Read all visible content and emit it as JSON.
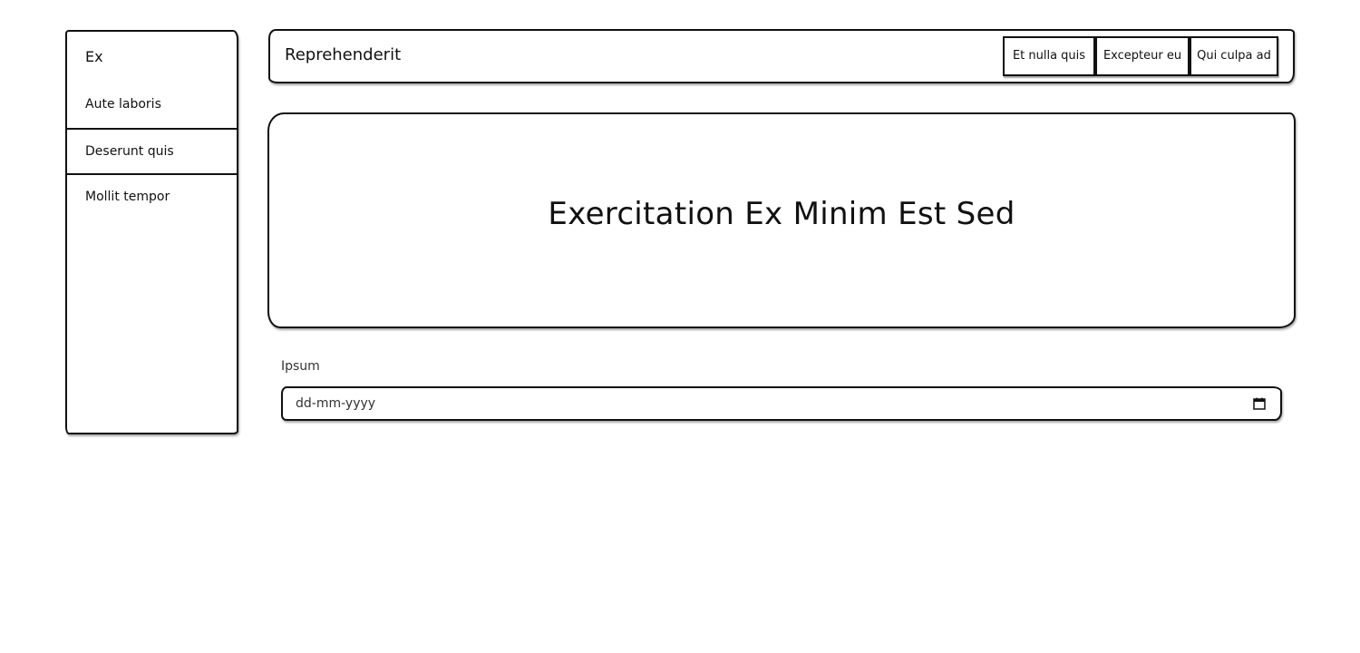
{
  "sidebar": {
    "brand": "Ex",
    "items": [
      {
        "label": "Aute laboris"
      },
      {
        "label": "Deserunt quis"
      },
      {
        "label": "Mollit tempor"
      }
    ]
  },
  "header": {
    "title": "Reprehenderit",
    "buttons": [
      {
        "label": "Et nulla quis"
      },
      {
        "label": "Excepteur eu"
      },
      {
        "label": "Qui culpa ad"
      }
    ]
  },
  "hero": {
    "title": "Exercitation Ex Minim Est Sed"
  },
  "form": {
    "date_label": "Ipsum",
    "date_value": "dd-mm-yyyy",
    "calendar_icon": "calendar-icon"
  }
}
